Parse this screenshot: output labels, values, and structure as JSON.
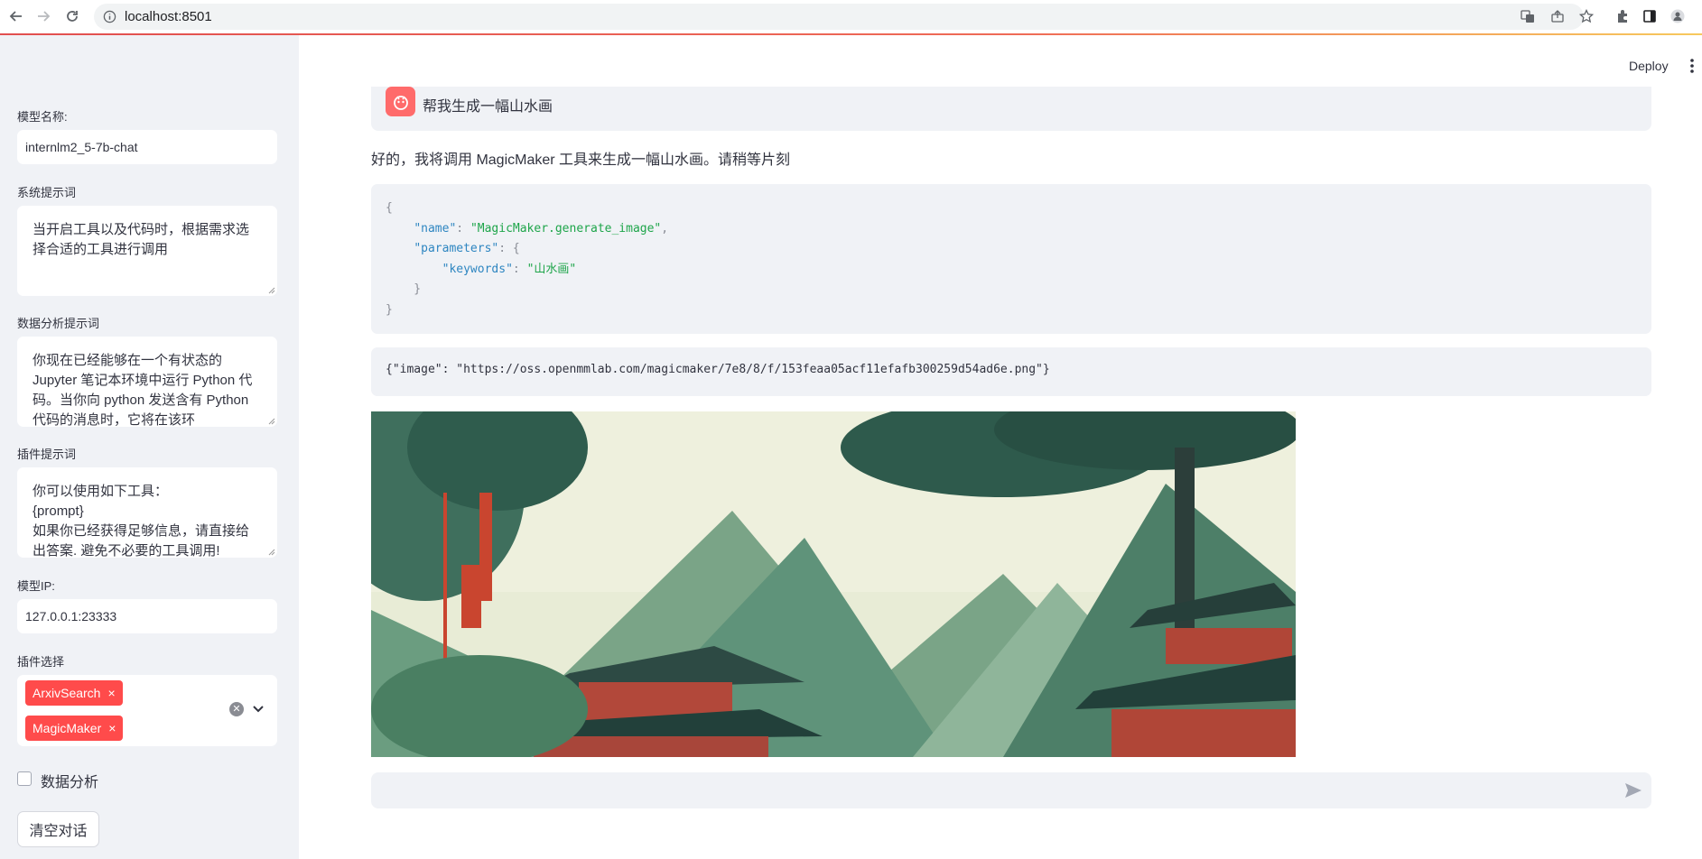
{
  "browser": {
    "url": "localhost:8501"
  },
  "sidebar": {
    "model_name_label": "模型名称:",
    "model_name_value": "internlm2_5-7b-chat",
    "system_prompt_label": "系统提示词",
    "system_prompt_value": "当开启工具以及代码时，根据需求选择合适的工具进行调用",
    "data_prompt_label": "数据分析提示词",
    "data_prompt_value": "你现在已经能够在一个有状态的 Jupyter 笔记本环境中运行 Python 代码。当你向 python 发送含有 Python 代码的消息时，它将在该环",
    "plugin_prompt_label": "插件提示词",
    "plugin_prompt_value": "你可以使用如下工具：\n{prompt}\n如果你已经获得足够信息，请直接给出答案. 避免不必要的工具调用!",
    "model_ip_label": "模型IP:",
    "model_ip_value": "127.0.0.1:23333",
    "plugin_select_label": "插件选择",
    "plugins": [
      "ArxivSearch",
      "MagicMaker"
    ],
    "tag_remove": "×",
    "clear_select": "✕",
    "data_analysis_label": "数据分析",
    "data_analysis_checked": false,
    "clear_button_label": "清空对话"
  },
  "main": {
    "deploy_label": "Deploy",
    "user_message": "帮我生成一幅山水画",
    "assistant_message": "好的，我将调用 MagicMaker 工具来生成一幅山水画。请稍等片刻",
    "code": {
      "name_key": "\"name\"",
      "name_value": "\"MagicMaker.generate_image\"",
      "params_key": "\"parameters\"",
      "keywords_key": "\"keywords\"",
      "keywords_value": "\"山水画\""
    },
    "result": "{\"image\": \"https://oss.openmmlab.com/magicmaker/7e8/8/f/153feaa05acf11efafb300259d54ad6e.png\"}",
    "chat_placeholder": ""
  },
  "colors": {
    "accent": "#ff4b4b",
    "sidebar_bg": "#f0f2f6",
    "code_key": "#2e86c1",
    "code_string": "#1ea54a"
  }
}
